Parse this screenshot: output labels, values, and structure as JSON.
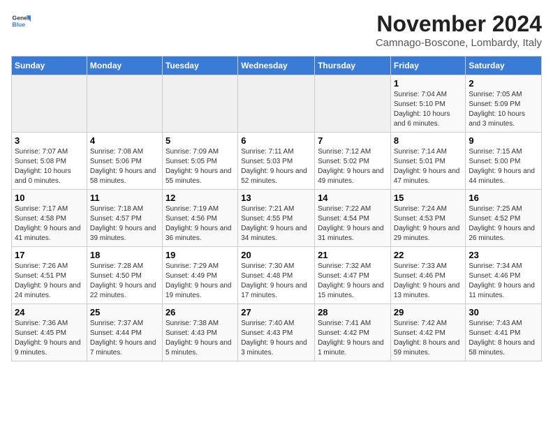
{
  "header": {
    "logo_general": "General",
    "logo_blue": "Blue",
    "month": "November 2024",
    "location": "Camnago-Boscone, Lombardy, Italy"
  },
  "weekdays": [
    "Sunday",
    "Monday",
    "Tuesday",
    "Wednesday",
    "Thursday",
    "Friday",
    "Saturday"
  ],
  "weeks": [
    [
      {
        "day": "",
        "info": ""
      },
      {
        "day": "",
        "info": ""
      },
      {
        "day": "",
        "info": ""
      },
      {
        "day": "",
        "info": ""
      },
      {
        "day": "",
        "info": ""
      },
      {
        "day": "1",
        "info": "Sunrise: 7:04 AM\nSunset: 5:10 PM\nDaylight: 10 hours and 6 minutes."
      },
      {
        "day": "2",
        "info": "Sunrise: 7:05 AM\nSunset: 5:09 PM\nDaylight: 10 hours and 3 minutes."
      }
    ],
    [
      {
        "day": "3",
        "info": "Sunrise: 7:07 AM\nSunset: 5:08 PM\nDaylight: 10 hours and 0 minutes."
      },
      {
        "day": "4",
        "info": "Sunrise: 7:08 AM\nSunset: 5:06 PM\nDaylight: 9 hours and 58 minutes."
      },
      {
        "day": "5",
        "info": "Sunrise: 7:09 AM\nSunset: 5:05 PM\nDaylight: 9 hours and 55 minutes."
      },
      {
        "day": "6",
        "info": "Sunrise: 7:11 AM\nSunset: 5:03 PM\nDaylight: 9 hours and 52 minutes."
      },
      {
        "day": "7",
        "info": "Sunrise: 7:12 AM\nSunset: 5:02 PM\nDaylight: 9 hours and 49 minutes."
      },
      {
        "day": "8",
        "info": "Sunrise: 7:14 AM\nSunset: 5:01 PM\nDaylight: 9 hours and 47 minutes."
      },
      {
        "day": "9",
        "info": "Sunrise: 7:15 AM\nSunset: 5:00 PM\nDaylight: 9 hours and 44 minutes."
      }
    ],
    [
      {
        "day": "10",
        "info": "Sunrise: 7:17 AM\nSunset: 4:58 PM\nDaylight: 9 hours and 41 minutes."
      },
      {
        "day": "11",
        "info": "Sunrise: 7:18 AM\nSunset: 4:57 PM\nDaylight: 9 hours and 39 minutes."
      },
      {
        "day": "12",
        "info": "Sunrise: 7:19 AM\nSunset: 4:56 PM\nDaylight: 9 hours and 36 minutes."
      },
      {
        "day": "13",
        "info": "Sunrise: 7:21 AM\nSunset: 4:55 PM\nDaylight: 9 hours and 34 minutes."
      },
      {
        "day": "14",
        "info": "Sunrise: 7:22 AM\nSunset: 4:54 PM\nDaylight: 9 hours and 31 minutes."
      },
      {
        "day": "15",
        "info": "Sunrise: 7:24 AM\nSunset: 4:53 PM\nDaylight: 9 hours and 29 minutes."
      },
      {
        "day": "16",
        "info": "Sunrise: 7:25 AM\nSunset: 4:52 PM\nDaylight: 9 hours and 26 minutes."
      }
    ],
    [
      {
        "day": "17",
        "info": "Sunrise: 7:26 AM\nSunset: 4:51 PM\nDaylight: 9 hours and 24 minutes."
      },
      {
        "day": "18",
        "info": "Sunrise: 7:28 AM\nSunset: 4:50 PM\nDaylight: 9 hours and 22 minutes."
      },
      {
        "day": "19",
        "info": "Sunrise: 7:29 AM\nSunset: 4:49 PM\nDaylight: 9 hours and 19 minutes."
      },
      {
        "day": "20",
        "info": "Sunrise: 7:30 AM\nSunset: 4:48 PM\nDaylight: 9 hours and 17 minutes."
      },
      {
        "day": "21",
        "info": "Sunrise: 7:32 AM\nSunset: 4:47 PM\nDaylight: 9 hours and 15 minutes."
      },
      {
        "day": "22",
        "info": "Sunrise: 7:33 AM\nSunset: 4:46 PM\nDaylight: 9 hours and 13 minutes."
      },
      {
        "day": "23",
        "info": "Sunrise: 7:34 AM\nSunset: 4:46 PM\nDaylight: 9 hours and 11 minutes."
      }
    ],
    [
      {
        "day": "24",
        "info": "Sunrise: 7:36 AM\nSunset: 4:45 PM\nDaylight: 9 hours and 9 minutes."
      },
      {
        "day": "25",
        "info": "Sunrise: 7:37 AM\nSunset: 4:44 PM\nDaylight: 9 hours and 7 minutes."
      },
      {
        "day": "26",
        "info": "Sunrise: 7:38 AM\nSunset: 4:43 PM\nDaylight: 9 hours and 5 minutes."
      },
      {
        "day": "27",
        "info": "Sunrise: 7:40 AM\nSunset: 4:43 PM\nDaylight: 9 hours and 3 minutes."
      },
      {
        "day": "28",
        "info": "Sunrise: 7:41 AM\nSunset: 4:42 PM\nDaylight: 9 hours and 1 minute."
      },
      {
        "day": "29",
        "info": "Sunrise: 7:42 AM\nSunset: 4:42 PM\nDaylight: 8 hours and 59 minutes."
      },
      {
        "day": "30",
        "info": "Sunrise: 7:43 AM\nSunset: 4:41 PM\nDaylight: 8 hours and 58 minutes."
      }
    ]
  ]
}
